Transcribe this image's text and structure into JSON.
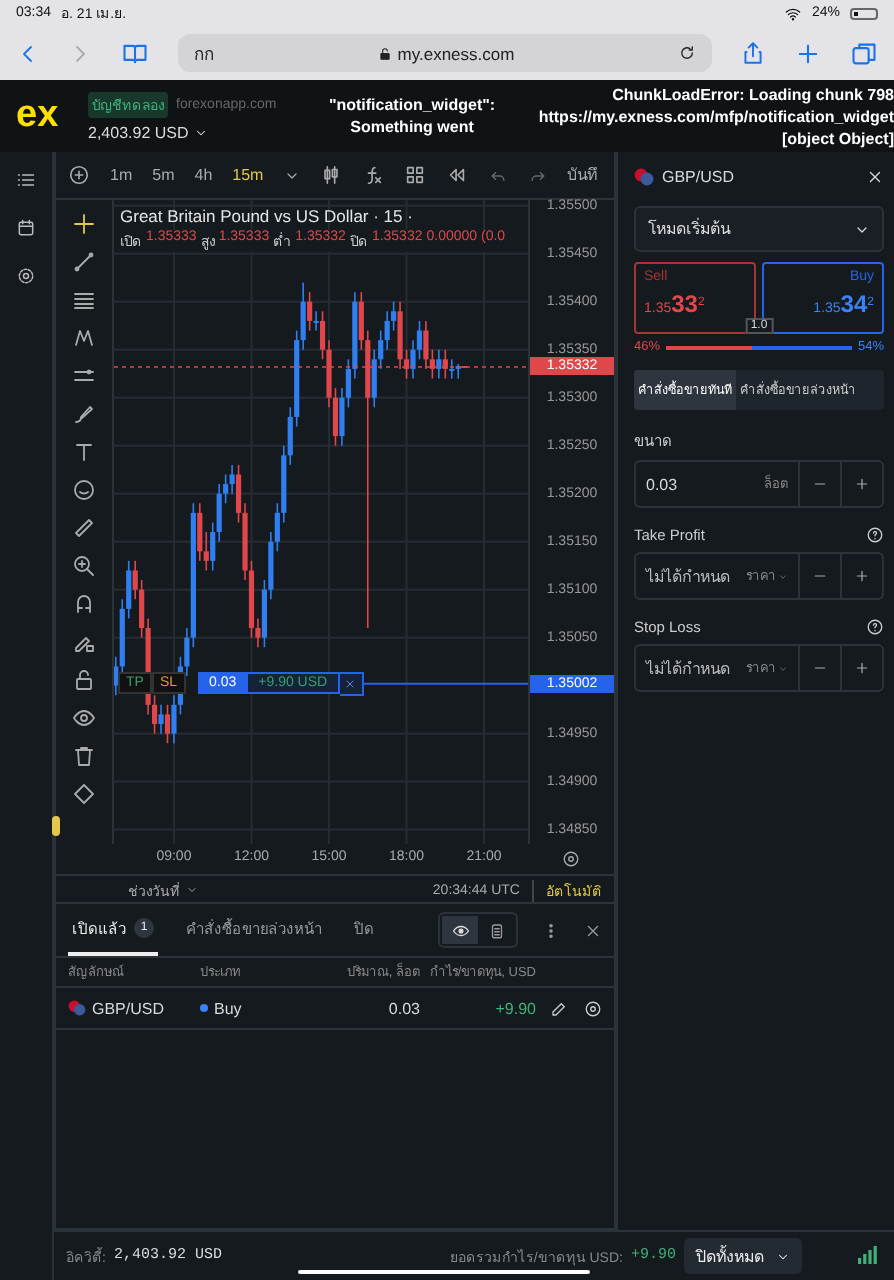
{
  "status_bar": {
    "time": "03:34",
    "date": "อ. 21 เม.ย.",
    "battery": "24%"
  },
  "browser": {
    "tab_text": "กก",
    "url": "my.exness.com"
  },
  "header": {
    "logo": "ex",
    "account_type": "บัญชีทดลอง",
    "server": "forexonapp.com",
    "balance": "2,403.92 USD",
    "error_left": [
      "\"notification_widget\":",
      "Something went"
    ],
    "error_right": [
      "ChunkLoadError: Loading chunk 798",
      "https://my.exness.com/mfp/notification_widget",
      "[object Object]"
    ]
  },
  "chart_toolbar": {
    "timeframes": [
      {
        "label": "1m",
        "selected": false
      },
      {
        "label": "5m",
        "selected": false
      },
      {
        "label": "4h",
        "selected": false
      },
      {
        "label": "15m",
        "selected": true
      }
    ],
    "save_label": "บันทึ"
  },
  "chart": {
    "title": "Great Britain Pound vs US Dollar · 15 ·",
    "ohlc": [
      {
        "label": "เปิด",
        "value": "1.35333"
      },
      {
        "label": "สูง",
        "value": "1.35333"
      },
      {
        "label": "ต่ำ",
        "value": "1.35332"
      },
      {
        "label": "ปิด",
        "value": "1.35332"
      }
    ],
    "change": "0.00000 (0.0",
    "price_tags": [
      {
        "label": "1.35332",
        "kind": "bid"
      },
      {
        "label": "1.35002",
        "kind": "position"
      }
    ],
    "chart_data": {
      "type": "candlestick",
      "xlim": [
        6.68,
        22.7
      ],
      "ylim": [
        1.34835,
        1.35506
      ],
      "grid": true,
      "ref_lines": [
        {
          "axis": "y",
          "value": 1.35332,
          "color": "#e0474b"
        },
        {
          "axis": "y",
          "value": 1.35002,
          "color": "#2563eb"
        }
      ],
      "x": [
        6.75,
        7,
        7.25,
        7.5,
        7.75,
        8,
        8.25,
        8.5,
        8.75,
        9,
        9.25,
        9.5,
        9.75,
        10,
        10.25,
        10.5,
        10.75,
        11,
        11.25,
        11.5,
        11.75,
        12,
        12.25,
        12.5,
        12.75,
        13,
        13.25,
        13.5,
        13.75,
        14,
        14.25,
        14.5,
        14.75,
        15,
        15.25,
        15.5,
        15.75,
        16,
        16.25,
        16.5,
        16.75,
        17,
        17.25,
        17.5,
        17.75,
        18,
        18.25,
        18.5,
        18.75,
        19,
        19.25,
        19.5,
        19.75,
        20,
        20.25
      ],
      "ohlc": [
        [
          1.35,
          1.3503,
          1.3499,
          1.3502
        ],
        [
          1.3502,
          1.3509,
          1.3501,
          1.3508
        ],
        [
          1.3508,
          1.3513,
          1.3507,
          1.3512
        ],
        [
          1.3512,
          1.3513,
          1.3509,
          1.351
        ],
        [
          1.351,
          1.3511,
          1.3505,
          1.3506
        ],
        [
          1.3506,
          1.3507,
          1.3497,
          1.3498
        ],
        [
          1.3498,
          1.3499,
          1.3495,
          1.3496
        ],
        [
          1.3496,
          1.3498,
          1.3495,
          1.3497
        ],
        [
          1.3497,
          1.3498,
          1.3494,
          1.3495
        ],
        [
          1.3495,
          1.3499,
          1.3494,
          1.3498
        ],
        [
          1.3498,
          1.3503,
          1.3497,
          1.3502
        ],
        [
          1.3502,
          1.3506,
          1.3501,
          1.3505
        ],
        [
          1.3505,
          1.3519,
          1.3504,
          1.3518
        ],
        [
          1.3518,
          1.3519,
          1.3513,
          1.3514
        ],
        [
          1.3514,
          1.3516,
          1.3512,
          1.3513
        ],
        [
          1.3513,
          1.3517,
          1.3512,
          1.3516
        ],
        [
          1.3516,
          1.3521,
          1.3515,
          1.352
        ],
        [
          1.352,
          1.3522,
          1.3519,
          1.3521
        ],
        [
          1.3521,
          1.3523,
          1.352,
          1.3522
        ],
        [
          1.3522,
          1.3523,
          1.3517,
          1.3518
        ],
        [
          1.3518,
          1.3519,
          1.3511,
          1.3512
        ],
        [
          1.3512,
          1.3513,
          1.3505,
          1.3506
        ],
        [
          1.3506,
          1.3507,
          1.3504,
          1.3505
        ],
        [
          1.3505,
          1.3511,
          1.3504,
          1.351
        ],
        [
          1.351,
          1.3516,
          1.3509,
          1.3515
        ],
        [
          1.3515,
          1.3519,
          1.3514,
          1.3518
        ],
        [
          1.3518,
          1.3525,
          1.3517,
          1.3524
        ],
        [
          1.3524,
          1.3529,
          1.3523,
          1.3528
        ],
        [
          1.3528,
          1.3537,
          1.3527,
          1.3536
        ],
        [
          1.3536,
          1.3542,
          1.3535,
          1.354
        ],
        [
          1.354,
          1.3541,
          1.3537,
          1.3538
        ],
        [
          1.3538,
          1.3539,
          1.3537,
          1.3538
        ],
        [
          1.3538,
          1.3539,
          1.3534,
          1.3535
        ],
        [
          1.3535,
          1.3536,
          1.3529,
          1.353
        ],
        [
          1.353,
          1.3531,
          1.3525,
          1.3526
        ],
        [
          1.3526,
          1.3531,
          1.3525,
          1.353
        ],
        [
          1.353,
          1.3534,
          1.3529,
          1.3533
        ],
        [
          1.3533,
          1.3541,
          1.3532,
          1.354
        ],
        [
          1.354,
          1.3541,
          1.3535,
          1.3536
        ],
        [
          1.3536,
          1.3537,
          1.3506,
          1.353
        ],
        [
          1.353,
          1.3535,
          1.3529,
          1.3534
        ],
        [
          1.3534,
          1.3537,
          1.3533,
          1.3536
        ],
        [
          1.3536,
          1.3539,
          1.3535,
          1.3538
        ],
        [
          1.3538,
          1.354,
          1.3537,
          1.3539
        ],
        [
          1.3539,
          1.354,
          1.3533,
          1.3534
        ],
        [
          1.3534,
          1.3535,
          1.3532,
          1.3533
        ],
        [
          1.3533,
          1.3536,
          1.3532,
          1.3535
        ],
        [
          1.3535,
          1.3538,
          1.3534,
          1.3537
        ],
        [
          1.3537,
          1.3538,
          1.3533,
          1.3534
        ],
        [
          1.3534,
          1.3535,
          1.3532,
          1.3533
        ],
        [
          1.3533,
          1.3535,
          1.3532,
          1.3534
        ],
        [
          1.3534,
          1.3535,
          1.3532,
          1.3533
        ],
        [
          1.3533,
          1.3534,
          1.3532,
          1.3533
        ],
        [
          1.3533,
          1.35335,
          1.3532,
          1.35333
        ],
        [
          1.35333,
          1.35333,
          1.35332,
          1.35332
        ]
      ],
      "yticks": [
        {
          "value": 1.355,
          "label": "1.35500"
        },
        {
          "value": 1.3545,
          "label": "1.35450"
        },
        {
          "value": 1.354,
          "label": "1.35400"
        },
        {
          "value": 1.3535,
          "label": "1.35350"
        },
        {
          "value": 1.353,
          "label": "1.35300"
        },
        {
          "value": 1.3525,
          "label": "1.35250"
        },
        {
          "value": 1.352,
          "label": "1.35200"
        },
        {
          "value": 1.3515,
          "label": "1.35150"
        },
        {
          "value": 1.351,
          "label": "1.35100"
        },
        {
          "value": 1.3505,
          "label": "1.35050"
        },
        {
          "value": 1.3495,
          "label": "1.34950"
        },
        {
          "value": 1.349,
          "label": "1.34900"
        },
        {
          "value": 1.3485,
          "label": "1.34850"
        }
      ],
      "xticks": [
        {
          "value": 9,
          "label": "09:00"
        },
        {
          "value": 12,
          "label": "12:00"
        },
        {
          "value": 15,
          "label": "15:00"
        },
        {
          "value": 18,
          "label": "18:00"
        },
        {
          "value": 21,
          "label": "21:00"
        }
      ]
    },
    "position": {
      "tp": "TP",
      "sl": "SL",
      "volume": "0.03",
      "profit": "+9.90 USD"
    },
    "range_label": "ช่วงวันที่",
    "clock": "20:34:44 UTC",
    "auto_label": "อัตโนมัติ"
  },
  "order_panel": {
    "symbol": "GBP/USD",
    "mode": "โหมดเริ่มต้น",
    "sell": {
      "label": "Sell",
      "prefix": "1.35",
      "big": "33",
      "sup": "2"
    },
    "buy": {
      "label": "Buy",
      "prefix": "1.35",
      "big": "34",
      "sup": "2"
    },
    "spread": "1.0",
    "sell_percent": "46%",
    "buy_percent": "54%",
    "level": 0.46,
    "order_types": [
      {
        "label": "คำสั่งซื้อขายทันที",
        "selected": true
      },
      {
        "label": "คำสั่งซื้อขายล่วงหน้า",
        "selected": false
      }
    ],
    "volume": {
      "label": "ขนาด",
      "value": "0.03",
      "unit": "ล็อต"
    },
    "take_profit": {
      "label": "Take Profit",
      "placeholder": "ไม่ได้กำหนด",
      "unit": "ราคา"
    },
    "stop_loss": {
      "label": "Stop Loss",
      "placeholder": "ไม่ได้กำหนด",
      "unit": "ราคา"
    }
  },
  "positions_panel": {
    "tabs": [
      {
        "label": "เปิดแล้ว",
        "count": "1",
        "selected": true
      },
      {
        "label": "คำสั่งซื้อขายล่วงหน้า",
        "selected": false
      },
      {
        "label": "ปิด",
        "selected": false
      }
    ],
    "view_modes": [
      {
        "selected": true
      },
      {
        "selected": false
      }
    ],
    "columns": [
      "สัญลักษณ์",
      "ประเภท",
      "ปริมาณ, ล็อต",
      "กำไร/ขาดทุน, USD"
    ],
    "rows": [
      {
        "symbol": "GBP/USD",
        "type": "Buy",
        "volume": "0.03",
        "profit": "+9.90"
      }
    ]
  },
  "footer": {
    "equity_label": "อิควิตี้:",
    "equity": "2,403.92 USD",
    "pnl_label": "ยอดรวมกำไร/ขาดทุน USD:",
    "pnl": "+9.90",
    "close_all": "ปิดทั้งหมด"
  }
}
